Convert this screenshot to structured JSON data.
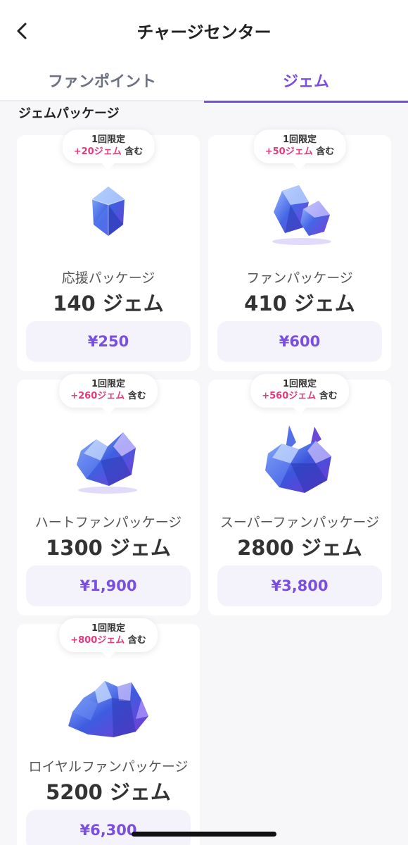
{
  "header": {
    "title": "チャージセンター",
    "back_icon": "chevron-left-icon"
  },
  "tabs": [
    {
      "label": "ファンポイント",
      "active": false
    },
    {
      "label": "ジェム",
      "active": true
    }
  ],
  "section": {
    "title": "ジェムパッケージ"
  },
  "packages": [
    {
      "limit": "1回限定",
      "bonus": "+20ジェム",
      "included": "含む",
      "name": "応援パッケージ",
      "amount": "140 ジェム",
      "price": "¥250",
      "icon": "gem-small-icon"
    },
    {
      "limit": "1回限定",
      "bonus": "+50ジェム",
      "included": "含む",
      "name": "ファンパッケージ",
      "amount": "410 ジェム",
      "price": "¥600",
      "icon": "gem-pair-icon"
    },
    {
      "limit": "1回限定",
      "bonus": "+260ジェム",
      "included": "含む",
      "name": "ハートファンパッケージ",
      "amount": "1300 ジェム",
      "price": "¥1,900",
      "icon": "gem-cluster-icon"
    },
    {
      "limit": "1回限定",
      "bonus": "+560ジェム",
      "included": "含む",
      "name": "スーパーファンパッケージ",
      "amount": "2800 ジェム",
      "price": "¥3,800",
      "icon": "gem-large-cluster-icon"
    },
    {
      "limit": "1回限定",
      "bonus": "+800ジェム",
      "included": "含む",
      "name": "ロイヤルファンパッケージ",
      "amount": "5200 ジェム",
      "price": "¥6,300",
      "icon": "gem-pile-icon"
    }
  ],
  "colors": {
    "accent": "#7a4fe0",
    "bonus": "#e43a7e",
    "background": "#f7f7fa"
  }
}
